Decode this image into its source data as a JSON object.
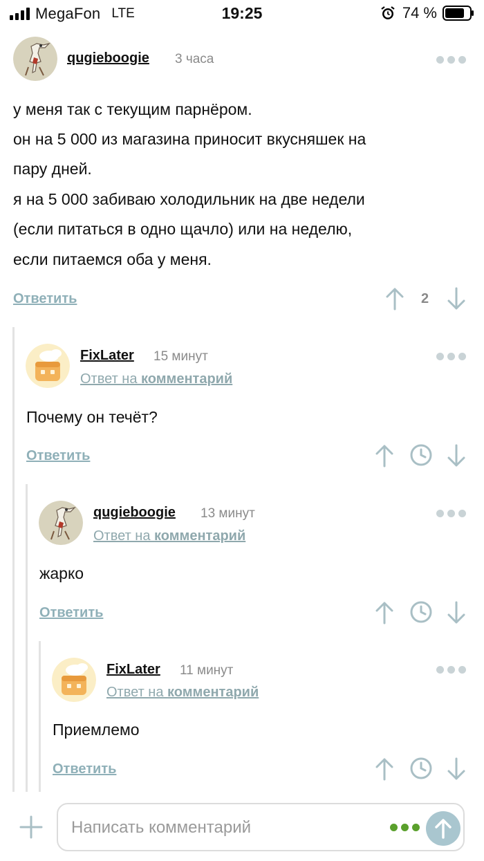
{
  "status_bar": {
    "carrier": "MegaFon",
    "network": "LTE",
    "time": "19:25",
    "battery": "74 %"
  },
  "comments": [
    {
      "username": "qugieboogie",
      "time": "3 часа",
      "lines": [
        "у меня так с текущим парнёром.",
        "он на 5 000 из магазина приносит вкусняшек на",
        "пару дней.",
        "я на 5 000 забиваю холодильник на две недели",
        "(если питаться в одно щачло) или на неделю,",
        "если питаемся оба у меня."
      ],
      "reply_label": "Ответить",
      "rating": "2"
    },
    {
      "username": "FixLater",
      "time": "15 минут",
      "reply_to_prefix": "Ответ на ",
      "reply_to_link": "комментарий",
      "lines": [
        "Почему он течёт?"
      ],
      "reply_label": "Ответить"
    },
    {
      "username": "qugieboogie",
      "time": "13 минут",
      "reply_to_prefix": "Ответ на ",
      "reply_to_link": "комментарий",
      "lines": [
        "жарко"
      ],
      "reply_label": "Ответить"
    },
    {
      "username": "FixLater",
      "time": "11 минут",
      "reply_to_prefix": "Ответ на ",
      "reply_to_link": "комментарий",
      "lines": [
        "Приемлемо"
      ],
      "reply_label": "Ответить"
    }
  ],
  "composer": {
    "placeholder": "Написать комментарий"
  },
  "colors": {
    "accent_link": "#8fb0b8",
    "icon_gray": "#a9bfc5",
    "send_button": "#a9c6cf",
    "dots_green": "#5aa02c"
  }
}
